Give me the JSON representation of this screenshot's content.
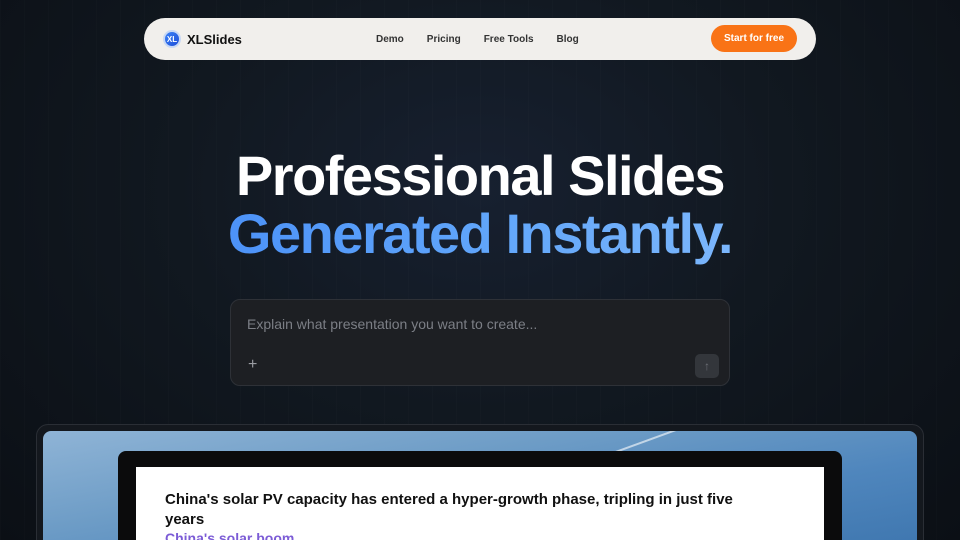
{
  "nav": {
    "logo_text": "XL",
    "brand": "XLSlides",
    "items": [
      {
        "label": "Demo"
      },
      {
        "label": "Pricing"
      },
      {
        "label": "Free Tools"
      },
      {
        "label": "Blog"
      }
    ],
    "cta_label": "Start for free"
  },
  "hero": {
    "line1": "Professional Slides",
    "line2": "Generated Instantly."
  },
  "prompt": {
    "placeholder": "Explain what presentation you want to create...",
    "plus_icon": "+",
    "send_icon": "↑"
  },
  "preview": {
    "slide_title": "China's solar PV capacity has entered a hyper-growth phase, tripling in just five years",
    "slide_subtitle": "China's solar boom"
  },
  "colors": {
    "accent": "#f97316",
    "gradient_start": "#3b82f6",
    "gradient_end": "#93c5fd",
    "subtitle": "#7c5cd6"
  }
}
